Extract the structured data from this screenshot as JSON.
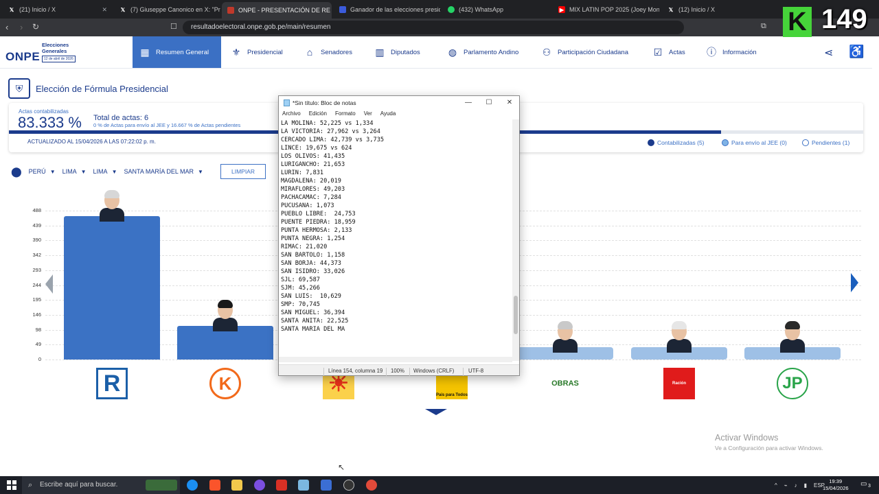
{
  "browser": {
    "tabs": [
      {
        "label": "(21) Inicio / X",
        "icon": "x-icon"
      },
      {
        "label": "(7) Giuseppe Canonico en X: \"Proye",
        "icon": "x-icon"
      },
      {
        "label": "ONPE - PRESENTACIÓN DE RE",
        "icon": "onpe-icon",
        "active": true
      },
      {
        "label": "Ganador de las elecciones presiden",
        "icon": "doc-icon"
      },
      {
        "label": "(432) WhatsApp",
        "icon": "whatsapp-icon"
      },
      {
        "label": "MIX LATIN POP 2025 (Joey Mon",
        "icon": "youtube-icon"
      },
      {
        "label": "(12) Inicio / X",
        "icon": "x-icon"
      }
    ],
    "url": "resultadoelectoral.onpe.gob.pe/main/resumen"
  },
  "overlay_badge": {
    "letter": "K",
    "number": "149"
  },
  "logo": {
    "name": "ONPE",
    "subtitle_1": "Elecciones",
    "subtitle_2": "Generales",
    "date": "12 de abril de 2026"
  },
  "nav": [
    {
      "label": "Resumen General",
      "icon": "grid-icon",
      "active": true
    },
    {
      "label": "Presidencial",
      "icon": "seal-icon"
    },
    {
      "label": "Senadores",
      "icon": "senate-icon"
    },
    {
      "label": "Diputados",
      "icon": "congress-icon"
    },
    {
      "label": "Parlamento Andino",
      "icon": "globe-icon"
    },
    {
      "label": "Participación Ciudadana",
      "icon": "people-icon"
    },
    {
      "label": "Actas",
      "icon": "checklist-icon"
    },
    {
      "label": "Información",
      "icon": "info-icon"
    }
  ],
  "page": {
    "title": "Elección de Fórmula Presidencial",
    "actas_label": "Actas contabilizadas",
    "actas_pct": "83.333 %",
    "actas_fraction": 0.83333,
    "total_actas": "Total de actas: 6",
    "sub_text": "0 % de Actas para envío al JEE y 16.667 % de Actas pendientes",
    "updated": "ACTUALIZADO AL 15/04/2026 A LAS 07:22:02 p. m.",
    "legend": [
      {
        "label": "Contabilizadas (5)",
        "color": "#1b3b8c"
      },
      {
        "label": "Para envío al JEE (0)",
        "color": "#7fb3e6"
      },
      {
        "label": "Pendientes (1)",
        "color": "#ffffff"
      }
    ]
  },
  "filters": {
    "country": "PERÚ",
    "department": "LIMA",
    "province": "LIMA",
    "district": "SANTA MARÍA DEL MAR",
    "clear_label": "LIMPIAR"
  },
  "chart_data": {
    "type": "bar",
    "yticks": [
      "488",
      "439",
      "390",
      "342",
      "293",
      "244",
      "195",
      "146",
      "98",
      "49",
      "0"
    ],
    "ylim": [
      0,
      488
    ],
    "series": [
      {
        "values": [
          470,
          110,
          null,
          null,
          36,
          36,
          36
        ]
      }
    ],
    "parties": [
      {
        "logo": "R",
        "color": "#1b5fa8"
      },
      {
        "logo": "K",
        "color": "#f26a1b"
      },
      {
        "logo": "☀",
        "color": "#e8311a"
      },
      {
        "logo": "Pais para Todos",
        "color": "#f5c400"
      },
      {
        "logo": "OBRAS",
        "color": "#2a7a2a"
      },
      {
        "logo": "Ración",
        "color": "#e01b1b"
      },
      {
        "logo": "JP",
        "color": "#2aa44a"
      }
    ]
  },
  "notepad": {
    "title": "*Sin título: Bloc de notas",
    "menu": [
      "Archivo",
      "Edición",
      "Formato",
      "Ver",
      "Ayuda"
    ],
    "lines": [
      "LA MOLINA: 52,225 vs 1,334",
      "LA VICTORIA: 27,962 vs 3,264",
      "CERCADO LIMA: 42,739 vs 3,735",
      "LINCE: 19,675 vs 624",
      "LOS OLIVOS: 41,435",
      "LURIGANCHO: 21,653",
      "LURIN: 7,831",
      "MAGDALENA: 20,019",
      "MIRAFLORES: 49,203",
      "PACHACAMAC: 7,284",
      "PUCUSANA: 1,073",
      "PUEBLO LIBRE:  24,753",
      "PUENTE PIEDRA: 18,959",
      "PUNTA HERMOSA: 2,133",
      "PUNTA NEGRA: 1,254",
      "RIMAC: 21,020",
      "SAN BARTOLO: 1,158",
      "SAN BORJA: 44,373",
      "SAN ISIDRO: 33,026",
      "SJL: 69,587",
      "SJM: 45,266",
      "SAN LUIS:  10,629",
      "SMP: 70,745",
      "SAN MIGUEL: 36,394",
      "SANTA ANITA: 22,525",
      "SANTA MARIA DEL MA"
    ],
    "status": {
      "position": "Línea 154, columna 19",
      "zoom": "100%",
      "line_ending": "Windows (CRLF)",
      "encoding": "UTF-8"
    }
  },
  "watermark": {
    "title": "Activar Windows",
    "subtitle": "Ve a Configuración para activar Windows."
  },
  "taskbar": {
    "search_placeholder": "Escribe aquí para buscar.",
    "lang": "ESP",
    "time": "19:39",
    "date": "15/04/2026",
    "notifications": "3"
  }
}
